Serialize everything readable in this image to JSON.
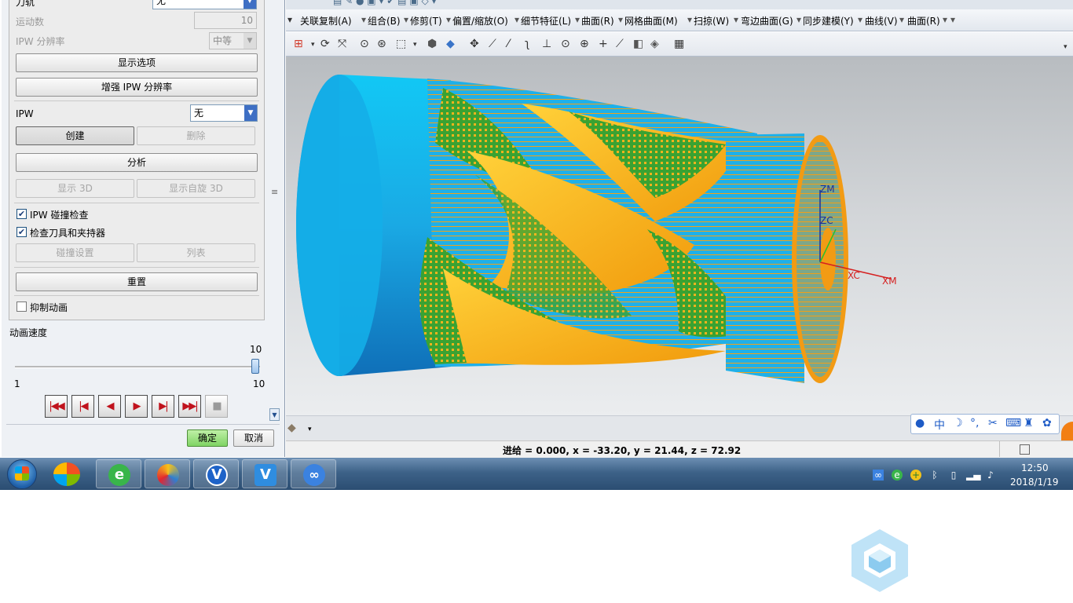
{
  "dialog": {
    "tool_path_label": "刀轨",
    "tool_path_value": "无",
    "motion_count_label": "运动数",
    "motion_count_value": "10",
    "ipw_resolution_label": "IPW 分辨率",
    "ipw_resolution_value": "中等",
    "display_options_button": "显示选项",
    "enhance_ipw_button": "增强 IPW 分辨率",
    "ipw_label": "IPW",
    "ipw_value": "无",
    "create_button": "创建",
    "delete_button": "删除",
    "analyze_button": "分析",
    "show_3d_button": "显示 3D",
    "show_spin_3d_button": "显示自旋 3D",
    "ipw_collision_check_label": "IPW 碰撞检查",
    "ipw_collision_check": true,
    "check_tool_holder_label": "检查刀具和夹持器",
    "check_tool_holder": true,
    "collision_settings_button": "碰撞设置",
    "list_button": "列表",
    "reset_button": "重置",
    "suppress_animation_label": "抑制动画",
    "suppress_animation": false,
    "animation_speed_label": "动画速度",
    "speed_max_top": "10",
    "speed_min": "1",
    "speed_max": "10",
    "speed_value": 10,
    "ok_button": "确定",
    "cancel_button": "取消"
  },
  "menubar": {
    "items": [
      "关联复制(A)",
      "组合(B)",
      "修剪(T)",
      "偏置/缩放(O)",
      "细节特征(L)",
      "曲面(R)",
      "网格曲面(M)",
      "扫掠(W)",
      "弯边曲面(G)",
      "同步建模(Y)",
      "曲线(V)",
      "曲面(R)"
    ]
  },
  "viewport": {
    "axis_zm": "ZM",
    "axis_zc": "ZC",
    "axis_xc": "XC",
    "axis_xm": "XM"
  },
  "statusbar": {
    "text": "进给 = 0.000, x = -33.20, y = 21.44, z = 72.92"
  },
  "ime": {
    "mode": "中"
  },
  "taskbar": {
    "time": "12:50",
    "date": "2018/1/19"
  }
}
